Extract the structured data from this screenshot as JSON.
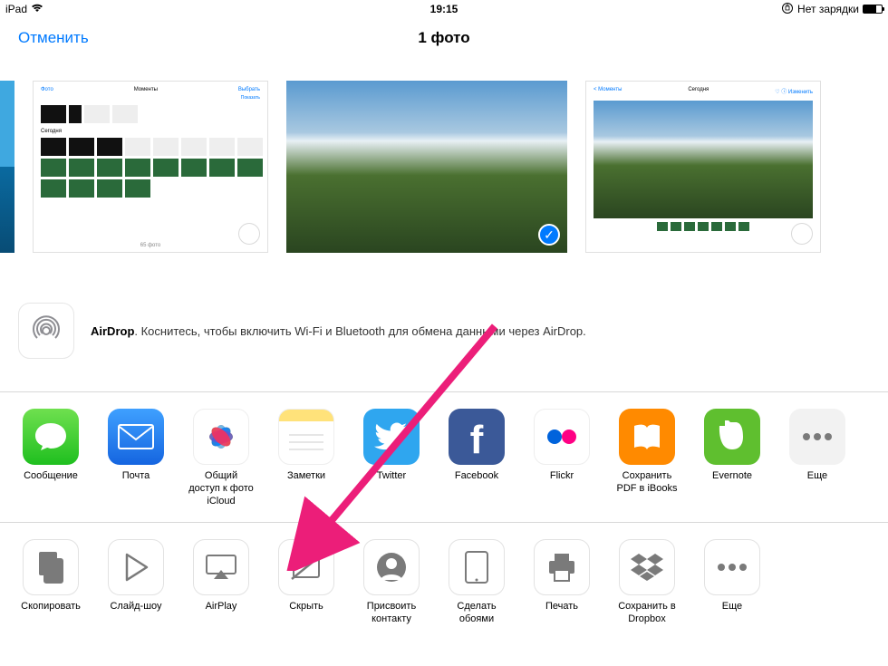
{
  "status": {
    "device": "iPad",
    "time": "19:15",
    "charging_text": "Нет зарядки"
  },
  "nav": {
    "cancel": "Отменить",
    "title": "1 фото"
  },
  "airdrop": {
    "name": "AirDrop",
    "hint": ". Коснитесь, чтобы включить Wi-Fi и Bluetooth для обмена данными через AirDrop."
  },
  "share": {
    "items": [
      {
        "label": "Сообщение"
      },
      {
        "label": "Почта"
      },
      {
        "label": "Общий доступ к фото iCloud"
      },
      {
        "label": "Заметки"
      },
      {
        "label": "Twitter"
      },
      {
        "label": "Facebook"
      },
      {
        "label": "Flickr"
      },
      {
        "label": "Сохранить PDF в iBooks"
      },
      {
        "label": "Evernote"
      },
      {
        "label": "Еще"
      }
    ]
  },
  "actions": {
    "items": [
      {
        "label": "Скопировать"
      },
      {
        "label": "Слайд-шоу"
      },
      {
        "label": "AirPlay"
      },
      {
        "label": "Скрыть"
      },
      {
        "label": "Присвоить контакту"
      },
      {
        "label": "Сделать обоями"
      },
      {
        "label": "Печать"
      },
      {
        "label": "Сохранить в Dropbox"
      },
      {
        "label": "Еще"
      }
    ]
  }
}
